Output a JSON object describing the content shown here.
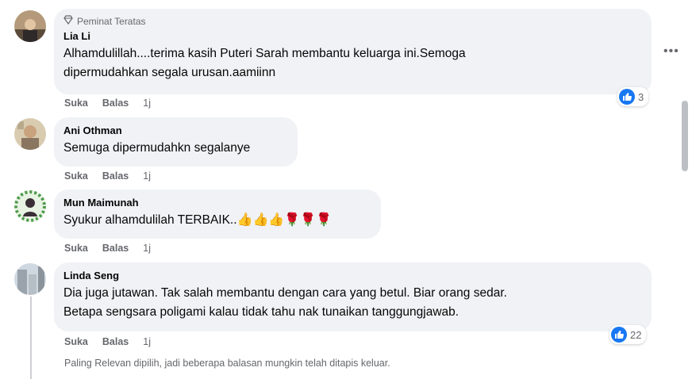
{
  "comments": [
    {
      "badge": "Peminat Teratas",
      "author": "Lia Li",
      "lines": [
        "Alhamdulillah....terima kasih Puteri Sarah membantu keluarga ini.Semoga",
        "dipermudahkan segala urusan.aamiinn"
      ],
      "like": "Suka",
      "reply": "Balas",
      "time": "1j",
      "reactions": "3"
    },
    {
      "author": "Ani Othman",
      "lines": [
        "Semuga dipermudahkn segalanye"
      ],
      "like": "Suka",
      "reply": "Balas",
      "time": "1j"
    },
    {
      "author": "Mun Maimunah",
      "lines": [
        "Syukur alhamdulilah TERBAIK.."
      ],
      "emojis": "👍👍👍🌹🌹🌹",
      "like": "Suka",
      "reply": "Balas",
      "time": "1j"
    },
    {
      "author": "Linda Seng",
      "lines": [
        "Dia juga jutawan. Tak salah membantu dengan cara yang betul. Biar orang sedar.",
        "Betapa sengsara poligami kalau tidak tahu nak tunaikan tanggungjawab."
      ],
      "like": "Suka",
      "reply": "Balas",
      "time": "1j",
      "reactions": "22"
    }
  ],
  "filter_note": "Paling Relevan dipilih, jadi beberapa balasan mungkin telah ditapis keluar.",
  "more_options": "•••",
  "colors": {
    "like_blue": "#1877f2",
    "bubble": "#f0f2f5",
    "muted": "#65676b"
  },
  "icons": [
    "diamond-icon",
    "like-reaction-icon",
    "more-options-icon"
  ]
}
